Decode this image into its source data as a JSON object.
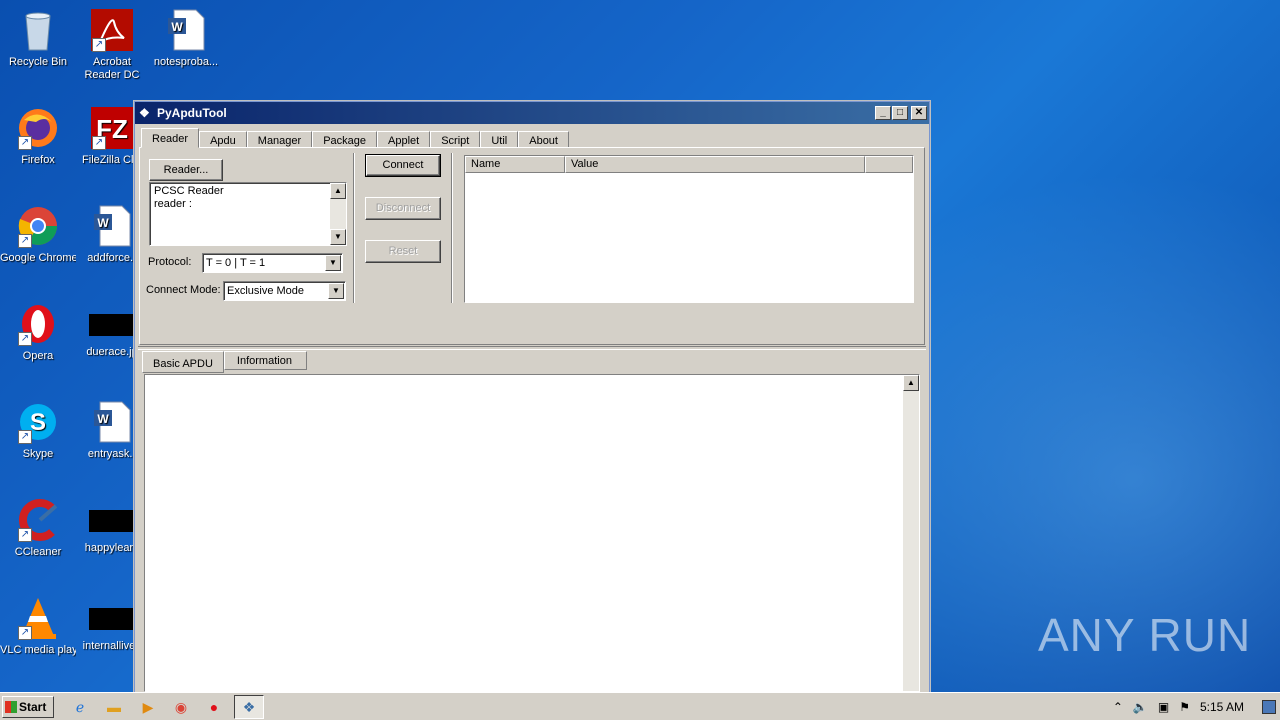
{
  "desktop": {
    "icons": [
      {
        "label": "Recycle Bin",
        "icon": "recycle-bin-icon"
      },
      {
        "label": "Acrobat Reader DC",
        "icon": "acrobat-icon"
      },
      {
        "label": "notesproba...",
        "icon": "word-doc-icon"
      },
      {
        "label": "Firefox",
        "icon": "firefox-icon"
      },
      {
        "label": "FileZilla Clie",
        "icon": "filezilla-icon"
      },
      {
        "label": "Google Chrome",
        "icon": "chrome-icon"
      },
      {
        "label": "addforce.r",
        "icon": "word-doc-icon"
      },
      {
        "label": "Opera",
        "icon": "opera-icon"
      },
      {
        "label": "duerace.jp",
        "icon": "image-file-icon"
      },
      {
        "label": "Skype",
        "icon": "skype-icon"
      },
      {
        "label": "entryask.r",
        "icon": "word-doc-icon"
      },
      {
        "label": "CCleaner",
        "icon": "ccleaner-icon"
      },
      {
        "label": "happylearn",
        "icon": "image-file-icon"
      },
      {
        "label": "VLC media player",
        "icon": "vlc-icon"
      },
      {
        "label": "internallivee",
        "icon": "image-file-icon"
      }
    ]
  },
  "window": {
    "title": "PyApduTool",
    "tabs": [
      "Reader",
      "Apdu",
      "Manager",
      "Package",
      "Applet",
      "Script",
      "Util",
      "About"
    ],
    "active_tab": "Reader",
    "reader_button": "Reader...",
    "reader_list": [
      "PCSC Reader",
      "reader :"
    ],
    "protocol_label": "Protocol:",
    "protocol_value": "T = 0 | T = 1",
    "connect_mode_label": "Connect Mode:",
    "connect_mode_value": "Exclusive Mode",
    "connect_button": "Connect",
    "disconnect_button": "Disconnect",
    "reset_button": "Reset",
    "grid_columns": [
      "Name",
      "Value",
      ""
    ],
    "bottom_tabs": [
      "Basic APDU",
      "Information"
    ],
    "active_bottom_tab": "Basic APDU"
  },
  "taskbar": {
    "start_label": "Start",
    "clock": "5:15 AM"
  },
  "watermark": "ANY RUN"
}
